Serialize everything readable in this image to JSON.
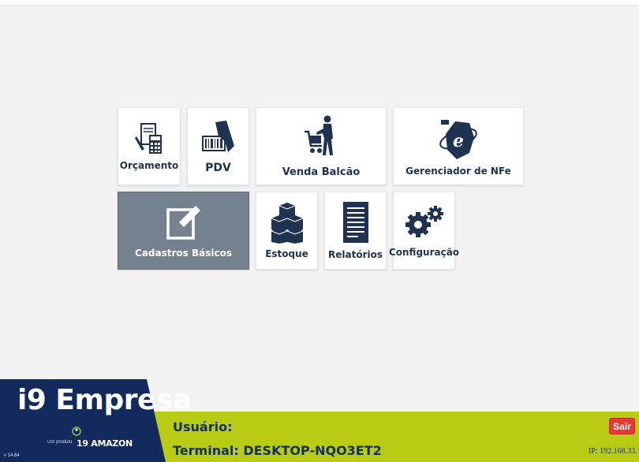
{
  "tiles": [
    {
      "id": "orcamento",
      "label": "Orçamento",
      "icon": "budget-calculator-icon"
    },
    {
      "id": "pdv",
      "label": "PDV",
      "icon": "barcode-scanner-icon"
    },
    {
      "id": "venda",
      "label": "Venda Balcão",
      "icon": "shopping-cart-person-icon"
    },
    {
      "id": "nfe",
      "label": "Gerenciador de NFe",
      "icon": "nfe-globe-icon"
    },
    {
      "id": "cadastros",
      "label": "Cadastros Básicos",
      "icon": "edit-form-icon",
      "selected": true
    },
    {
      "id": "estoque",
      "label": "Estoque",
      "icon": "stacked-boxes-icon"
    },
    {
      "id": "relatorios",
      "label": "Relatórios",
      "icon": "report-document-icon"
    },
    {
      "id": "config",
      "label": "Configuração",
      "icon": "gears-icon"
    }
  ],
  "footer": {
    "brand_title": "i9 Empresa",
    "brand_sub": "Um produto",
    "brand_logo_text": "19 AMAZON",
    "version": "v 14.64",
    "user_label": "Usuário:",
    "terminal_label": "Terminal:",
    "terminal_value": "DESKTOP-NQO3ET2",
    "exit_label": "Sair",
    "ip": "IP: 192.168.33.1"
  },
  "colors": {
    "footer_green": "#b7cc12",
    "brand_navy": "#122a5c",
    "tile_selected": "#74828f",
    "exit_red": "#e53935",
    "text_navy": "#15305e"
  }
}
